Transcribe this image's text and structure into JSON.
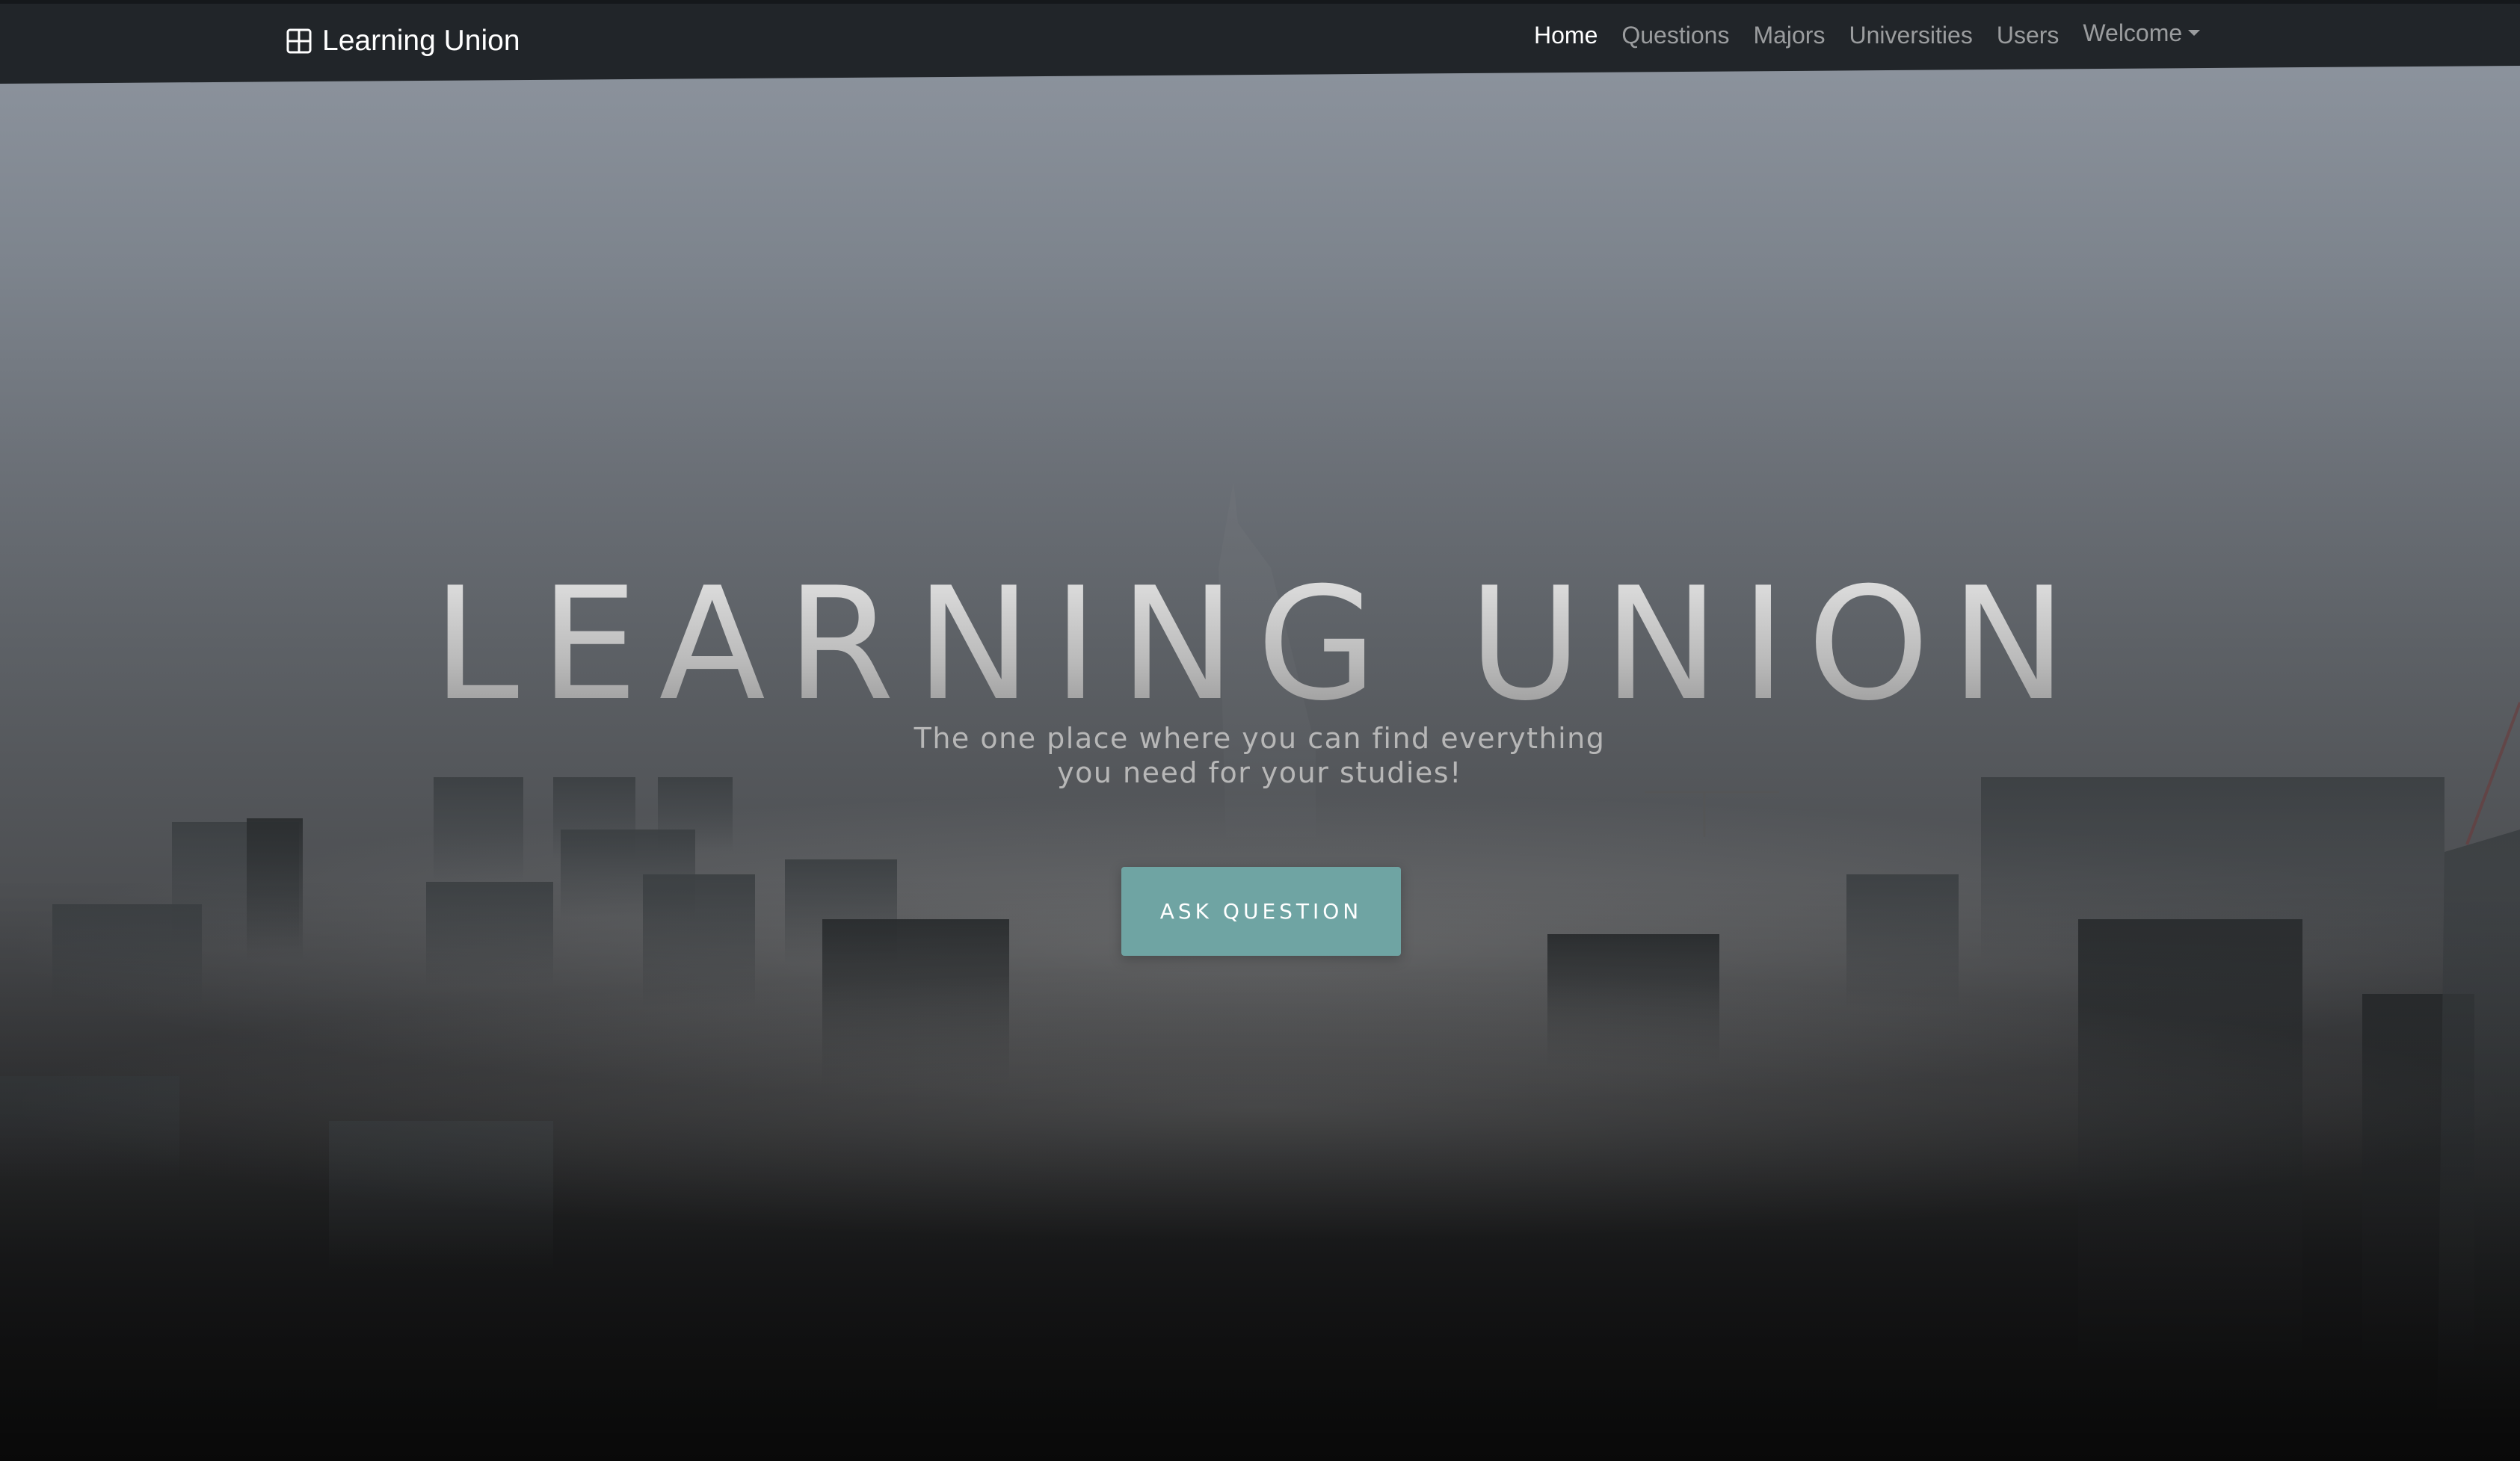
{
  "navbar": {
    "brand": {
      "label": "Learning Union",
      "icon": "grid-icon"
    },
    "links": [
      {
        "label": "Home",
        "active": true
      },
      {
        "label": "Questions",
        "active": false
      },
      {
        "label": "Majors",
        "active": false
      },
      {
        "label": "Universities",
        "active": false
      },
      {
        "label": "Users",
        "active": false
      }
    ],
    "dropdown": {
      "label": "Welcome",
      "icon": "caret-down-icon"
    }
  },
  "hero": {
    "title": "LEARNING UNION",
    "subtitle": "The one place where you can find everything you need for your studies!",
    "cta_label": "ASK QUESTION",
    "background": "foggy city skyline"
  },
  "colors": {
    "navbar_bg": "#212529",
    "cta_bg": "#6fa4a3",
    "nav_active": "#ffffff",
    "nav_inactive": "rgba(255,255,255,0.55)"
  }
}
